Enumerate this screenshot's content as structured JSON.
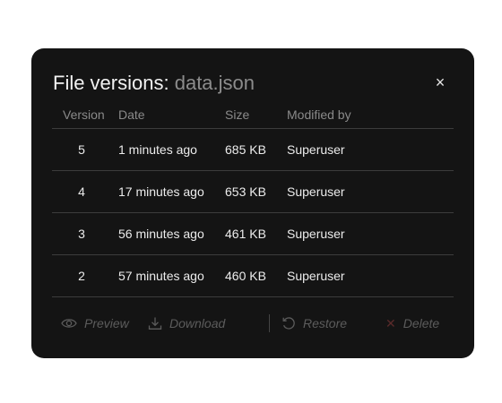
{
  "dialog": {
    "title_prefix": "File versions: ",
    "filename": "data.json",
    "close_glyph": "×"
  },
  "table": {
    "headers": [
      "Version",
      "Date",
      "Size",
      "Modified by"
    ],
    "rows": [
      {
        "version": "5",
        "date": "1 minutes ago",
        "size": "685 KB",
        "modified_by": "Superuser"
      },
      {
        "version": "4",
        "date": "17 minutes ago",
        "size": "653 KB",
        "modified_by": "Superuser"
      },
      {
        "version": "3",
        "date": "56 minutes ago",
        "size": "461 KB",
        "modified_by": "Superuser"
      },
      {
        "version": "2",
        "date": "57 minutes ago",
        "size": "460 KB",
        "modified_by": "Superuser"
      }
    ]
  },
  "toolbar": {
    "preview_label": "Preview",
    "download_label": "Download",
    "restore_label": "Restore",
    "delete_label": "Delete",
    "preview_icon": "eye-icon",
    "download_icon": "download-icon",
    "restore_icon": "restore-icon",
    "delete_icon": "close-icon",
    "disabled_color": "#5c5c5c",
    "delete_icon_color": "#5a2a2a"
  },
  "colors": {
    "dialog_bg": "#141414",
    "text": "#ececec",
    "muted": "#8a8a8a",
    "divider": "#3c3c3c"
  }
}
